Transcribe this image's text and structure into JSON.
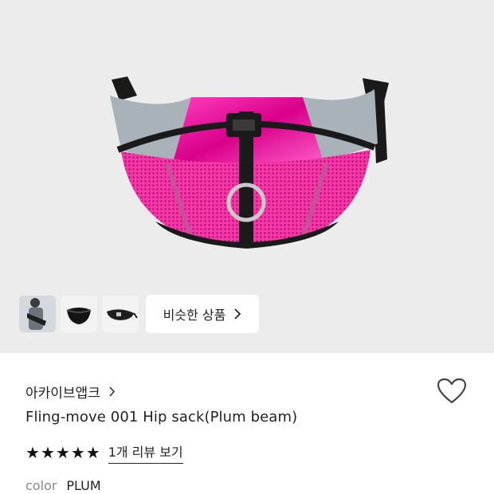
{
  "gallery": {
    "thumbnails": [
      "person-wearing-bag",
      "black-bag",
      "bag-side-view"
    ],
    "similar_button_label": "비슷한 상품"
  },
  "product": {
    "brand": "아카이브앱크",
    "title": "Fling-move 001 Hip sack(Plum beam)",
    "rating_stars": 5,
    "review_link": "1개 리뷰 보기",
    "color_label": "color",
    "color_value": "PLUM"
  },
  "colors": {
    "bag_pink": "#e0109a",
    "bag_grey": "#a9b2b8",
    "strap_black": "#1a1a1a",
    "hero_bg": "#ececec"
  }
}
